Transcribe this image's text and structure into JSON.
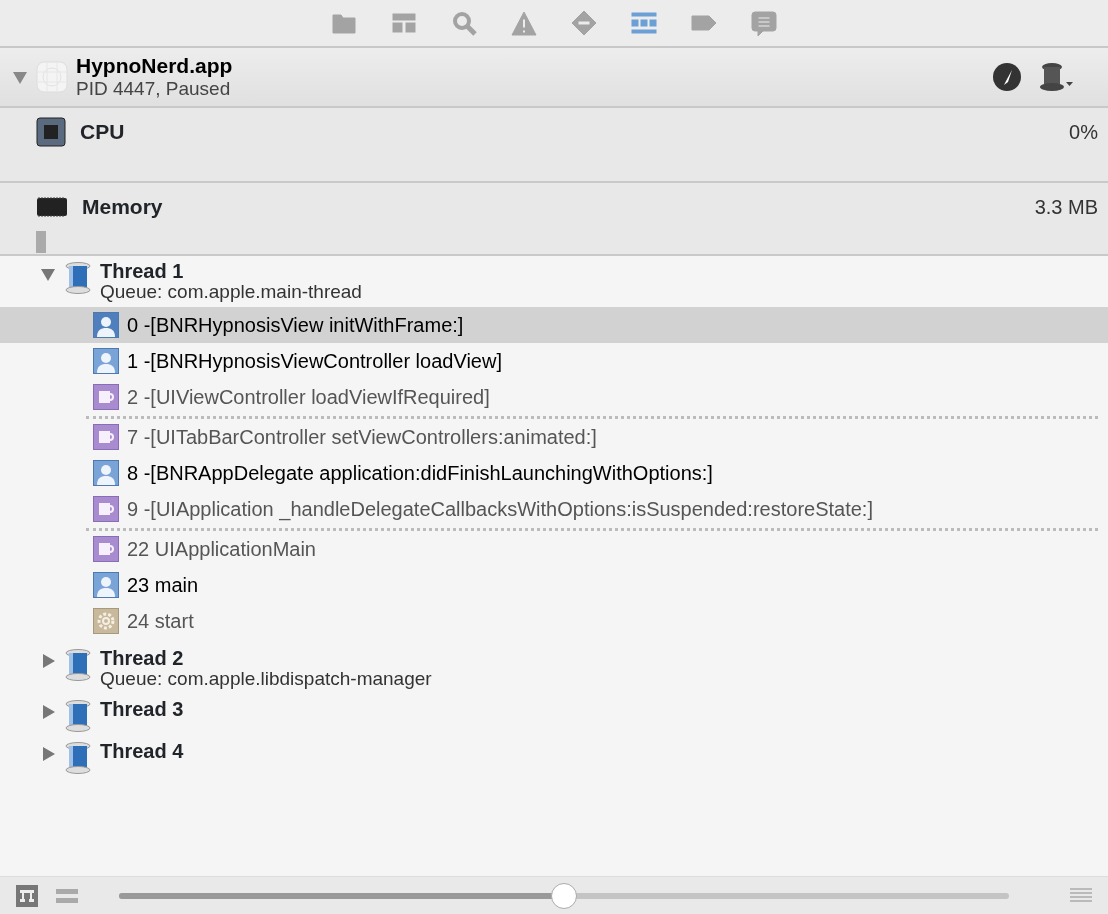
{
  "navigator_tabs": [
    {
      "kind": "folder",
      "selected": false
    },
    {
      "kind": "hierarchy",
      "selected": false
    },
    {
      "kind": "search",
      "selected": false
    },
    {
      "kind": "warning",
      "selected": false
    },
    {
      "kind": "breakpoint",
      "selected": false
    },
    {
      "kind": "debug",
      "selected": true
    },
    {
      "kind": "tag",
      "selected": false
    },
    {
      "kind": "log",
      "selected": false
    }
  ],
  "process": {
    "name": "HypnoNerd.app",
    "status": "PID 4447, Paused",
    "expanded": true
  },
  "gauges": [
    {
      "kind": "cpu",
      "name": "CPU",
      "reading": "0%"
    },
    {
      "kind": "memory",
      "name": "Memory",
      "reading": "3.3 MB"
    }
  ],
  "threads": [
    {
      "name": "Thread 1",
      "queue": "Queue: com.apple.main-thread",
      "expanded": true,
      "frames": [
        {
          "kind": "user",
          "text": "0 -[BNRHypnosisView initWithFrame:]",
          "selected": true
        },
        {
          "kind": "user",
          "text": "1 -[BNRHypnosisViewController loadView]",
          "selected": false
        },
        {
          "kind": "system",
          "text": "2 -[UIViewController loadViewIfRequired]",
          "selected": false
        },
        {
          "kind": "separator"
        },
        {
          "kind": "system",
          "text": "7 -[UITabBarController setViewControllers:animated:]",
          "selected": false
        },
        {
          "kind": "user",
          "text": "8 -[BNRAppDelegate application:didFinishLaunchingWithOptions:]",
          "selected": false
        },
        {
          "kind": "system",
          "text": "9 -[UIApplication _handleDelegateCallbacksWithOptions:isSuspended:restoreState:]",
          "selected": false
        },
        {
          "kind": "separator"
        },
        {
          "kind": "system",
          "text": "22 UIApplicationMain",
          "selected": false
        },
        {
          "kind": "user",
          "text": "23 main",
          "selected": false
        },
        {
          "kind": "start",
          "text": "24 start",
          "selected": false
        }
      ]
    },
    {
      "name": "Thread 2",
      "queue": "Queue: com.apple.libdispatch-manager",
      "expanded": false
    },
    {
      "name": "Thread 3",
      "expanded": false
    },
    {
      "name": "Thread 4",
      "expanded": false
    }
  ],
  "filter_slider": {
    "level": 0.5
  }
}
